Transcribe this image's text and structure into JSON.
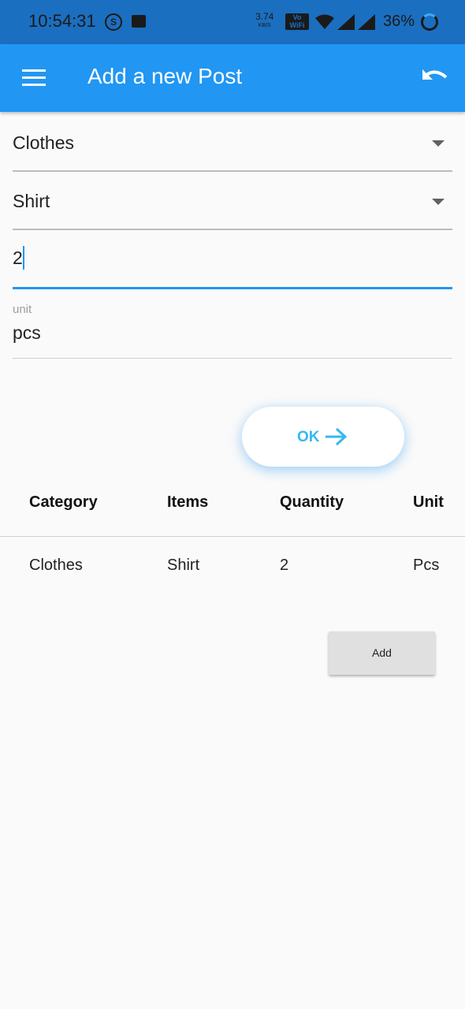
{
  "status_bar": {
    "time": "10:54:31",
    "s_badge": "S",
    "speed_value": "3.74",
    "speed_unit": "KB/S",
    "vowifi_top": "Vo",
    "vowifi_bottom": "WiFi",
    "battery": "36%"
  },
  "app_bar": {
    "title": "Add a new Post",
    "menu_icon": "menu-icon",
    "undo_icon": "undo-icon"
  },
  "form": {
    "category_value": "Clothes",
    "item_value": "Shirt",
    "quantity_value": "2",
    "unit_label": "unit",
    "unit_value": "pcs"
  },
  "ok_button": {
    "label": "OK"
  },
  "table": {
    "headers": [
      "Category",
      "Items",
      "Quantity",
      "Unit"
    ],
    "rows": [
      [
        "Clothes",
        "Shirt",
        "2",
        "Pcs"
      ]
    ]
  },
  "add_button": {
    "label": "Add"
  },
  "colors": {
    "status_bar": "#1b6fc0",
    "app_bar": "#2196f3",
    "ok_text": "#36b8f0",
    "background": "#fafafa"
  }
}
